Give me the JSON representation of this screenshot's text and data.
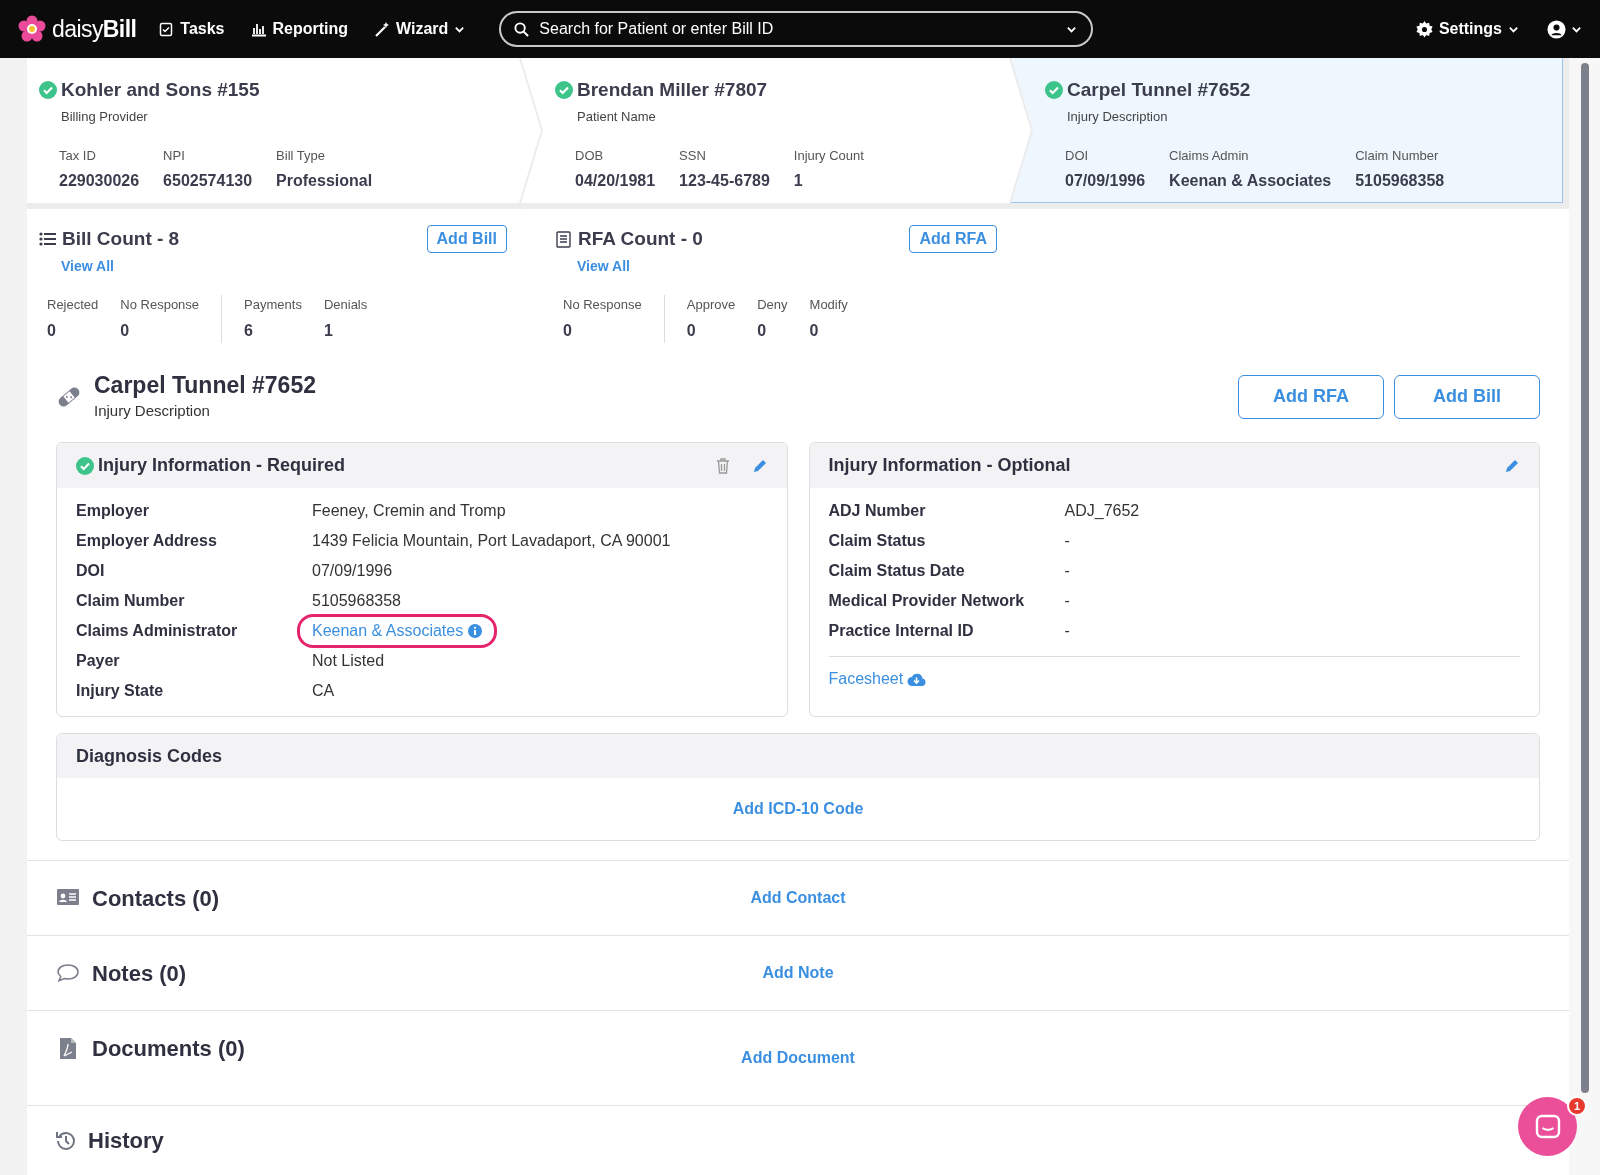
{
  "navbar": {
    "logo": "daisy**Bill**",
    "items": [
      {
        "kind": "tasks",
        "label": "Tasks",
        "dropdown": false
      },
      {
        "kind": "reporting",
        "label": "Reporting",
        "dropdown": false
      },
      {
        "kind": "wizard",
        "label": "Wizard",
        "dropdown": true
      }
    ],
    "search": {
      "placeholder": "Search for Patient or enter Bill ID"
    },
    "settings": "Settings"
  },
  "crumbs": [
    {
      "title": "Kohler and Sons #155",
      "subtitle": "Billing Provider",
      "verified": true,
      "selected": false,
      "fields": [
        {
          "label": "Tax ID",
          "value": "229030026"
        },
        {
          "label": "NPI",
          "value": "6502574130"
        },
        {
          "label": "Bill Type",
          "value": "Professional"
        }
      ]
    },
    {
      "title": "Brendan Miller #7807",
      "subtitle": "Patient Name",
      "verified": true,
      "selected": false,
      "fields": [
        {
          "label": "DOB",
          "value": "04/20/1981"
        },
        {
          "label": "SSN",
          "value": "123-45-6789"
        },
        {
          "label": "Injury Count",
          "value": "1"
        }
      ]
    },
    {
      "title": "Carpel Tunnel #7652",
      "subtitle": "Injury Description",
      "verified": true,
      "selected": true,
      "fields": [
        {
          "label": "DOI",
          "value": "07/09/1996"
        },
        {
          "label": "Claims Admin",
          "value": "Keenan & Associates"
        },
        {
          "label": "Claim Number",
          "value": "5105968358"
        }
      ]
    }
  ],
  "counts": [
    {
      "kind": "bill",
      "title": "Bill Count - 8",
      "link": "View All",
      "button": "Add Bill",
      "groups": [
        [
          {
            "label": "Rejected",
            "value": "0"
          },
          {
            "label": "No Response",
            "value": "0"
          }
        ],
        [
          {
            "label": "Payments",
            "value": "6"
          },
          {
            "label": "Denials",
            "value": "1"
          }
        ]
      ]
    },
    {
      "kind": "rfa",
      "title": "RFA Count - 0",
      "link": "View All",
      "button": "Add RFA",
      "groups": [
        [
          {
            "label": "No Response",
            "value": "0"
          }
        ],
        [
          {
            "label": "Approve",
            "value": "0"
          },
          {
            "label": "Deny",
            "value": "0"
          },
          {
            "label": "Modify",
            "value": "0"
          }
        ]
      ]
    }
  ],
  "injury": {
    "title": "Carpel Tunnel #7652",
    "subtitle": "Injury Description",
    "buttons": [
      "Add RFA",
      "Add Bill"
    ]
  },
  "panels": [
    {
      "title": "Injury Information - Required",
      "verified": true,
      "deletable": true,
      "fields": [
        {
          "label": "Employer",
          "value": "Feeney, Cremin and Tromp",
          "kind": "text",
          "highlighted": false
        },
        {
          "label": "Employer Address",
          "value": "1439 Felicia Mountain, Port Lavadaport, CA 90001",
          "kind": "text",
          "highlighted": false
        },
        {
          "label": "DOI",
          "value": "07/09/1996",
          "kind": "text",
          "highlighted": false
        },
        {
          "label": "Claim Number",
          "value": "5105968358",
          "kind": "text",
          "highlighted": false
        },
        {
          "label": "Claims Administrator",
          "value": "Keenan & Associates",
          "kind": "link",
          "highlighted": true
        },
        {
          "label": "Payer",
          "value": "Not Listed",
          "kind": "text",
          "highlighted": false
        },
        {
          "label": "Injury State",
          "value": "CA",
          "kind": "text",
          "highlighted": false
        }
      ]
    },
    {
      "title": "Injury Information - Optional",
      "verified": false,
      "deletable": false,
      "fields": [
        {
          "label": "ADJ Number",
          "value": "ADJ_7652",
          "kind": "text",
          "highlighted": false
        },
        {
          "label": "Claim Status",
          "value": "-",
          "kind": "text",
          "highlighted": false
        },
        {
          "label": "Claim Status Date",
          "value": "-",
          "kind": "text",
          "highlighted": false
        },
        {
          "label": "Medical Provider Network",
          "value": "-",
          "kind": "text",
          "highlighted": false
        },
        {
          "label": "Practice Internal ID",
          "value": "-",
          "kind": "text",
          "highlighted": false
        }
      ],
      "link": "Facesheet"
    }
  ],
  "diagnosis": {
    "title": "Diagnosis Codes",
    "link": "Add ICD-10 Code"
  },
  "sections": [
    {
      "kind": "contacts",
      "title": "Contacts (0)",
      "action": "Add Contact"
    },
    {
      "kind": "notes",
      "title": "Notes (0)",
      "action": "Add Note"
    },
    {
      "kind": "documents",
      "title": "Documents (0)",
      "action": "Add Document"
    }
  ],
  "history": {
    "title": "History"
  },
  "chat": {
    "badge": "1"
  }
}
